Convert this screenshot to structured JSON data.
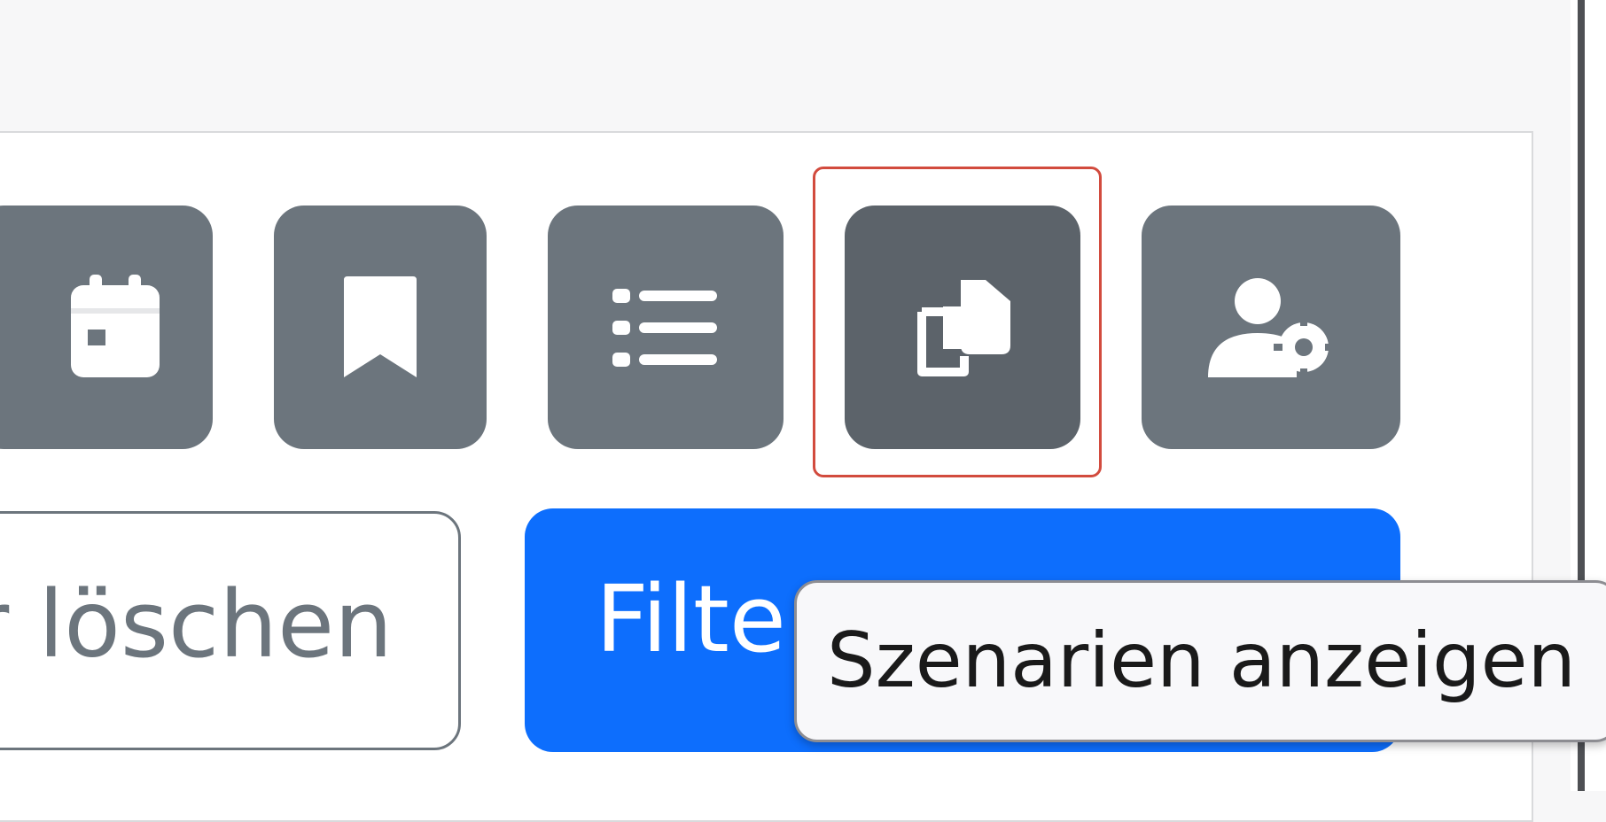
{
  "toolbar": {
    "icon_buttons": [
      {
        "name": "calendar-icon"
      },
      {
        "name": "bookmark-icon"
      },
      {
        "name": "list-icon"
      },
      {
        "name": "copy-icon",
        "state": "hovered"
      },
      {
        "name": "user-gear-icon"
      }
    ]
  },
  "actions": {
    "clear_label": "r löschen",
    "filter_label": "Filte"
  },
  "tooltip": {
    "text": "Szenarien anzeigen"
  },
  "colors": {
    "secondary": "#6c757d",
    "secondary_hover": "#5c636a",
    "primary": "#0d6efd",
    "focus_ring": "#d24b3e"
  }
}
